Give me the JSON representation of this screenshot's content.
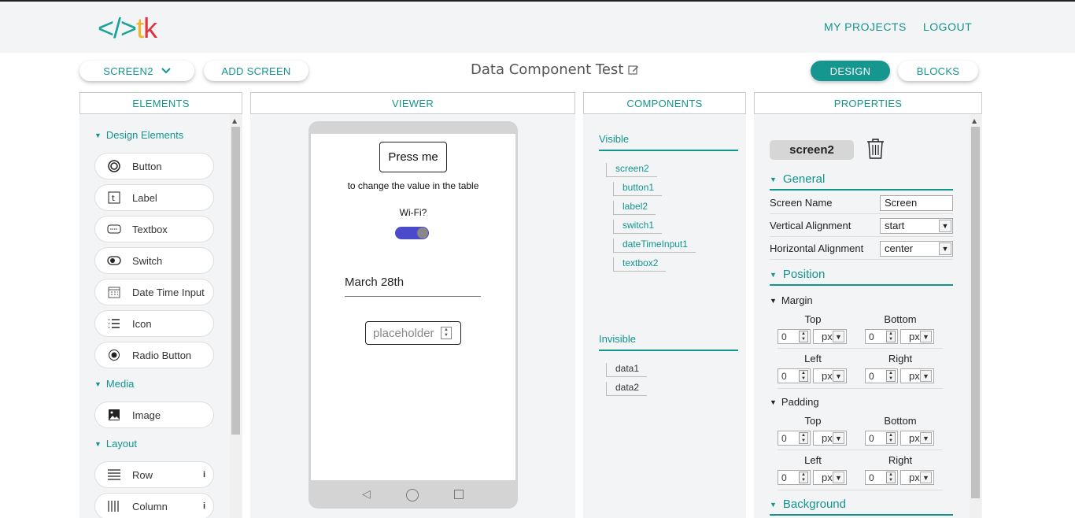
{
  "header": {
    "logo": {
      "part1": "</>",
      "part2": "t",
      "part3": "k"
    },
    "my_projects": "MY PROJECTS",
    "logout": "LOGOUT"
  },
  "toolbar": {
    "screen_select": "SCREEN2",
    "add_screen": "ADD SCREEN",
    "project_title": "Data Component Test",
    "design": "DESIGN",
    "blocks": "BLOCKS"
  },
  "panels": {
    "elements": "ELEMENTS",
    "viewer": "VIEWER",
    "components": "COMPONENTS",
    "properties": "PROPERTIES"
  },
  "elements": {
    "design_section": "Design Elements",
    "media_section": "Media",
    "layout_section": "Layout",
    "items": [
      {
        "label": "Button",
        "icon": "button-icon"
      },
      {
        "label": "Label",
        "icon": "label-icon"
      },
      {
        "label": "Textbox",
        "icon": "textbox-icon"
      },
      {
        "label": "Switch",
        "icon": "switch-icon"
      },
      {
        "label": "Date Time Input",
        "icon": "calendar-icon"
      },
      {
        "label": "Icon",
        "icon": "list-icon"
      },
      {
        "label": "Radio Button",
        "icon": "radio-icon"
      }
    ],
    "media_items": [
      {
        "label": "Image",
        "icon": "image-icon"
      }
    ],
    "layout_items": [
      {
        "label": "Row",
        "icon": "row-icon",
        "info": "i"
      },
      {
        "label": "Column",
        "icon": "column-icon",
        "info": "i"
      }
    ]
  },
  "viewer": {
    "button_text": "Press me",
    "label_text": "to change the value in the table",
    "switch_label": "Wi-Fi?",
    "switch_on": true,
    "date_value": "March 28th",
    "textbox_placeholder": "placeholder"
  },
  "components": {
    "visible_title": "Visible",
    "visible_tree": [
      "screen2",
      "button1",
      "label2",
      "switch1",
      "dateTimeInput1",
      "textbox2"
    ],
    "invisible_title": "Invisible",
    "invisible_tree": [
      "data1",
      "data2"
    ]
  },
  "properties": {
    "screen_name_badge": "screen2",
    "general_title": "General",
    "screen_name_label": "Screen Name",
    "screen_name_value": "Screen",
    "vertical_label": "Vertical Alignment",
    "vertical_value": "start",
    "horizontal_label": "Horizontal Alignment",
    "horizontal_value": "center",
    "position_title": "Position",
    "margin_title": "Margin",
    "padding_title": "Padding",
    "top": "Top",
    "bottom": "Bottom",
    "left": "Left",
    "right": "Right",
    "zero": "0",
    "unit": "px",
    "background_title": "Background"
  },
  "colors": {
    "accent": "#15968e",
    "switch_track": "#4a4acb"
  }
}
